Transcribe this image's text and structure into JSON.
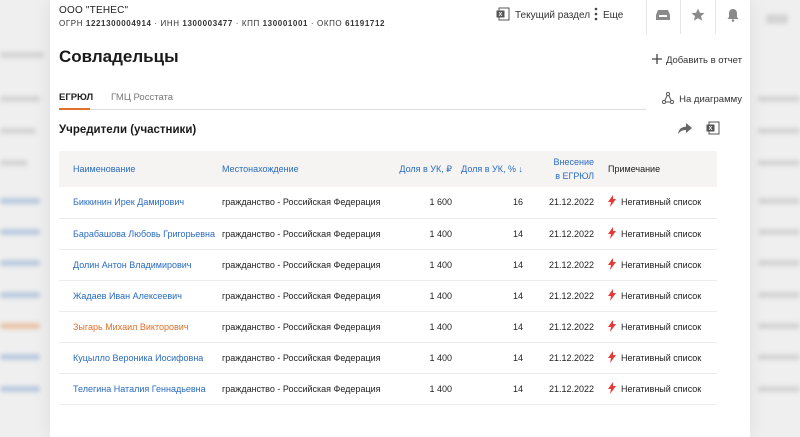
{
  "company": {
    "name": "ООО \"ТЕНЕС\"",
    "ogrn_label": "ОГРН",
    "ogrn": "1221300004914",
    "inn_label": "ИНН",
    "inn": "1300003477",
    "kpp_label": "КПП",
    "kpp": "130001001",
    "okpo_label": "ОКПО",
    "okpo": "61191712"
  },
  "toolbar": {
    "current_section": "Текущий раздел",
    "more": "Еще"
  },
  "page": {
    "title": "Совладельцы",
    "add_to_report": "Добавить в отчет",
    "to_diagram": "На диаграмму"
  },
  "tabs": [
    {
      "label": "ЕГРЮЛ",
      "active": true
    },
    {
      "label": "ГМЦ Росстата",
      "active": false
    }
  ],
  "section": {
    "title": "Учредители (участники)"
  },
  "table": {
    "headers": {
      "name": "Наименование",
      "location": "Местонахождение",
      "share_rub": "Доля в УК, ₽",
      "share_pct": "Доля в УК, % ↓",
      "added_line1": "Внесение",
      "added_line2": "в ЕГРЮЛ",
      "note": "Примечание"
    },
    "rows": [
      {
        "name": "Биккинин Ирек Дамирович",
        "location": "гражданство - Российская Федерация",
        "share_rub": "1 600",
        "share_pct": "16",
        "date": "21.12.2022",
        "note": "Негативный список",
        "highlight": false
      },
      {
        "name": "Барабашова Любовь Григорьевна",
        "location": "гражданство - Российская Федерация",
        "share_rub": "1 400",
        "share_pct": "14",
        "date": "21.12.2022",
        "note": "Негативный список",
        "highlight": false
      },
      {
        "name": "Долин Антон Владимирович",
        "location": "гражданство - Российская Федерация",
        "share_rub": "1 400",
        "share_pct": "14",
        "date": "21.12.2022",
        "note": "Негативный список",
        "highlight": false
      },
      {
        "name": "Жадаев Иван Алексеевич",
        "location": "гражданство - Российская Федерация",
        "share_rub": "1 400",
        "share_pct": "14",
        "date": "21.12.2022",
        "note": "Негативный список",
        "highlight": false
      },
      {
        "name": "Зыгарь Михаил Викторович",
        "location": "гражданство - Российская Федерация",
        "share_rub": "1 400",
        "share_pct": "14",
        "date": "21.12.2022",
        "note": "Негативный список",
        "highlight": true
      },
      {
        "name": "Куцылло Вероника Иосифовна",
        "location": "гражданство - Российская Федерация",
        "share_rub": "1 400",
        "share_pct": "14",
        "date": "21.12.2022",
        "note": "Негативный список",
        "highlight": false
      },
      {
        "name": "Телегина Наталия Геннадьевна",
        "location": "гражданство - Российская Федерация",
        "share_rub": "1 400",
        "share_pct": "14",
        "date": "21.12.2022",
        "note": "Негативный список",
        "highlight": false
      }
    ]
  },
  "colors": {
    "accent": "#e0702a",
    "link": "#2a6bc0",
    "negative_icon": "#e53935"
  }
}
